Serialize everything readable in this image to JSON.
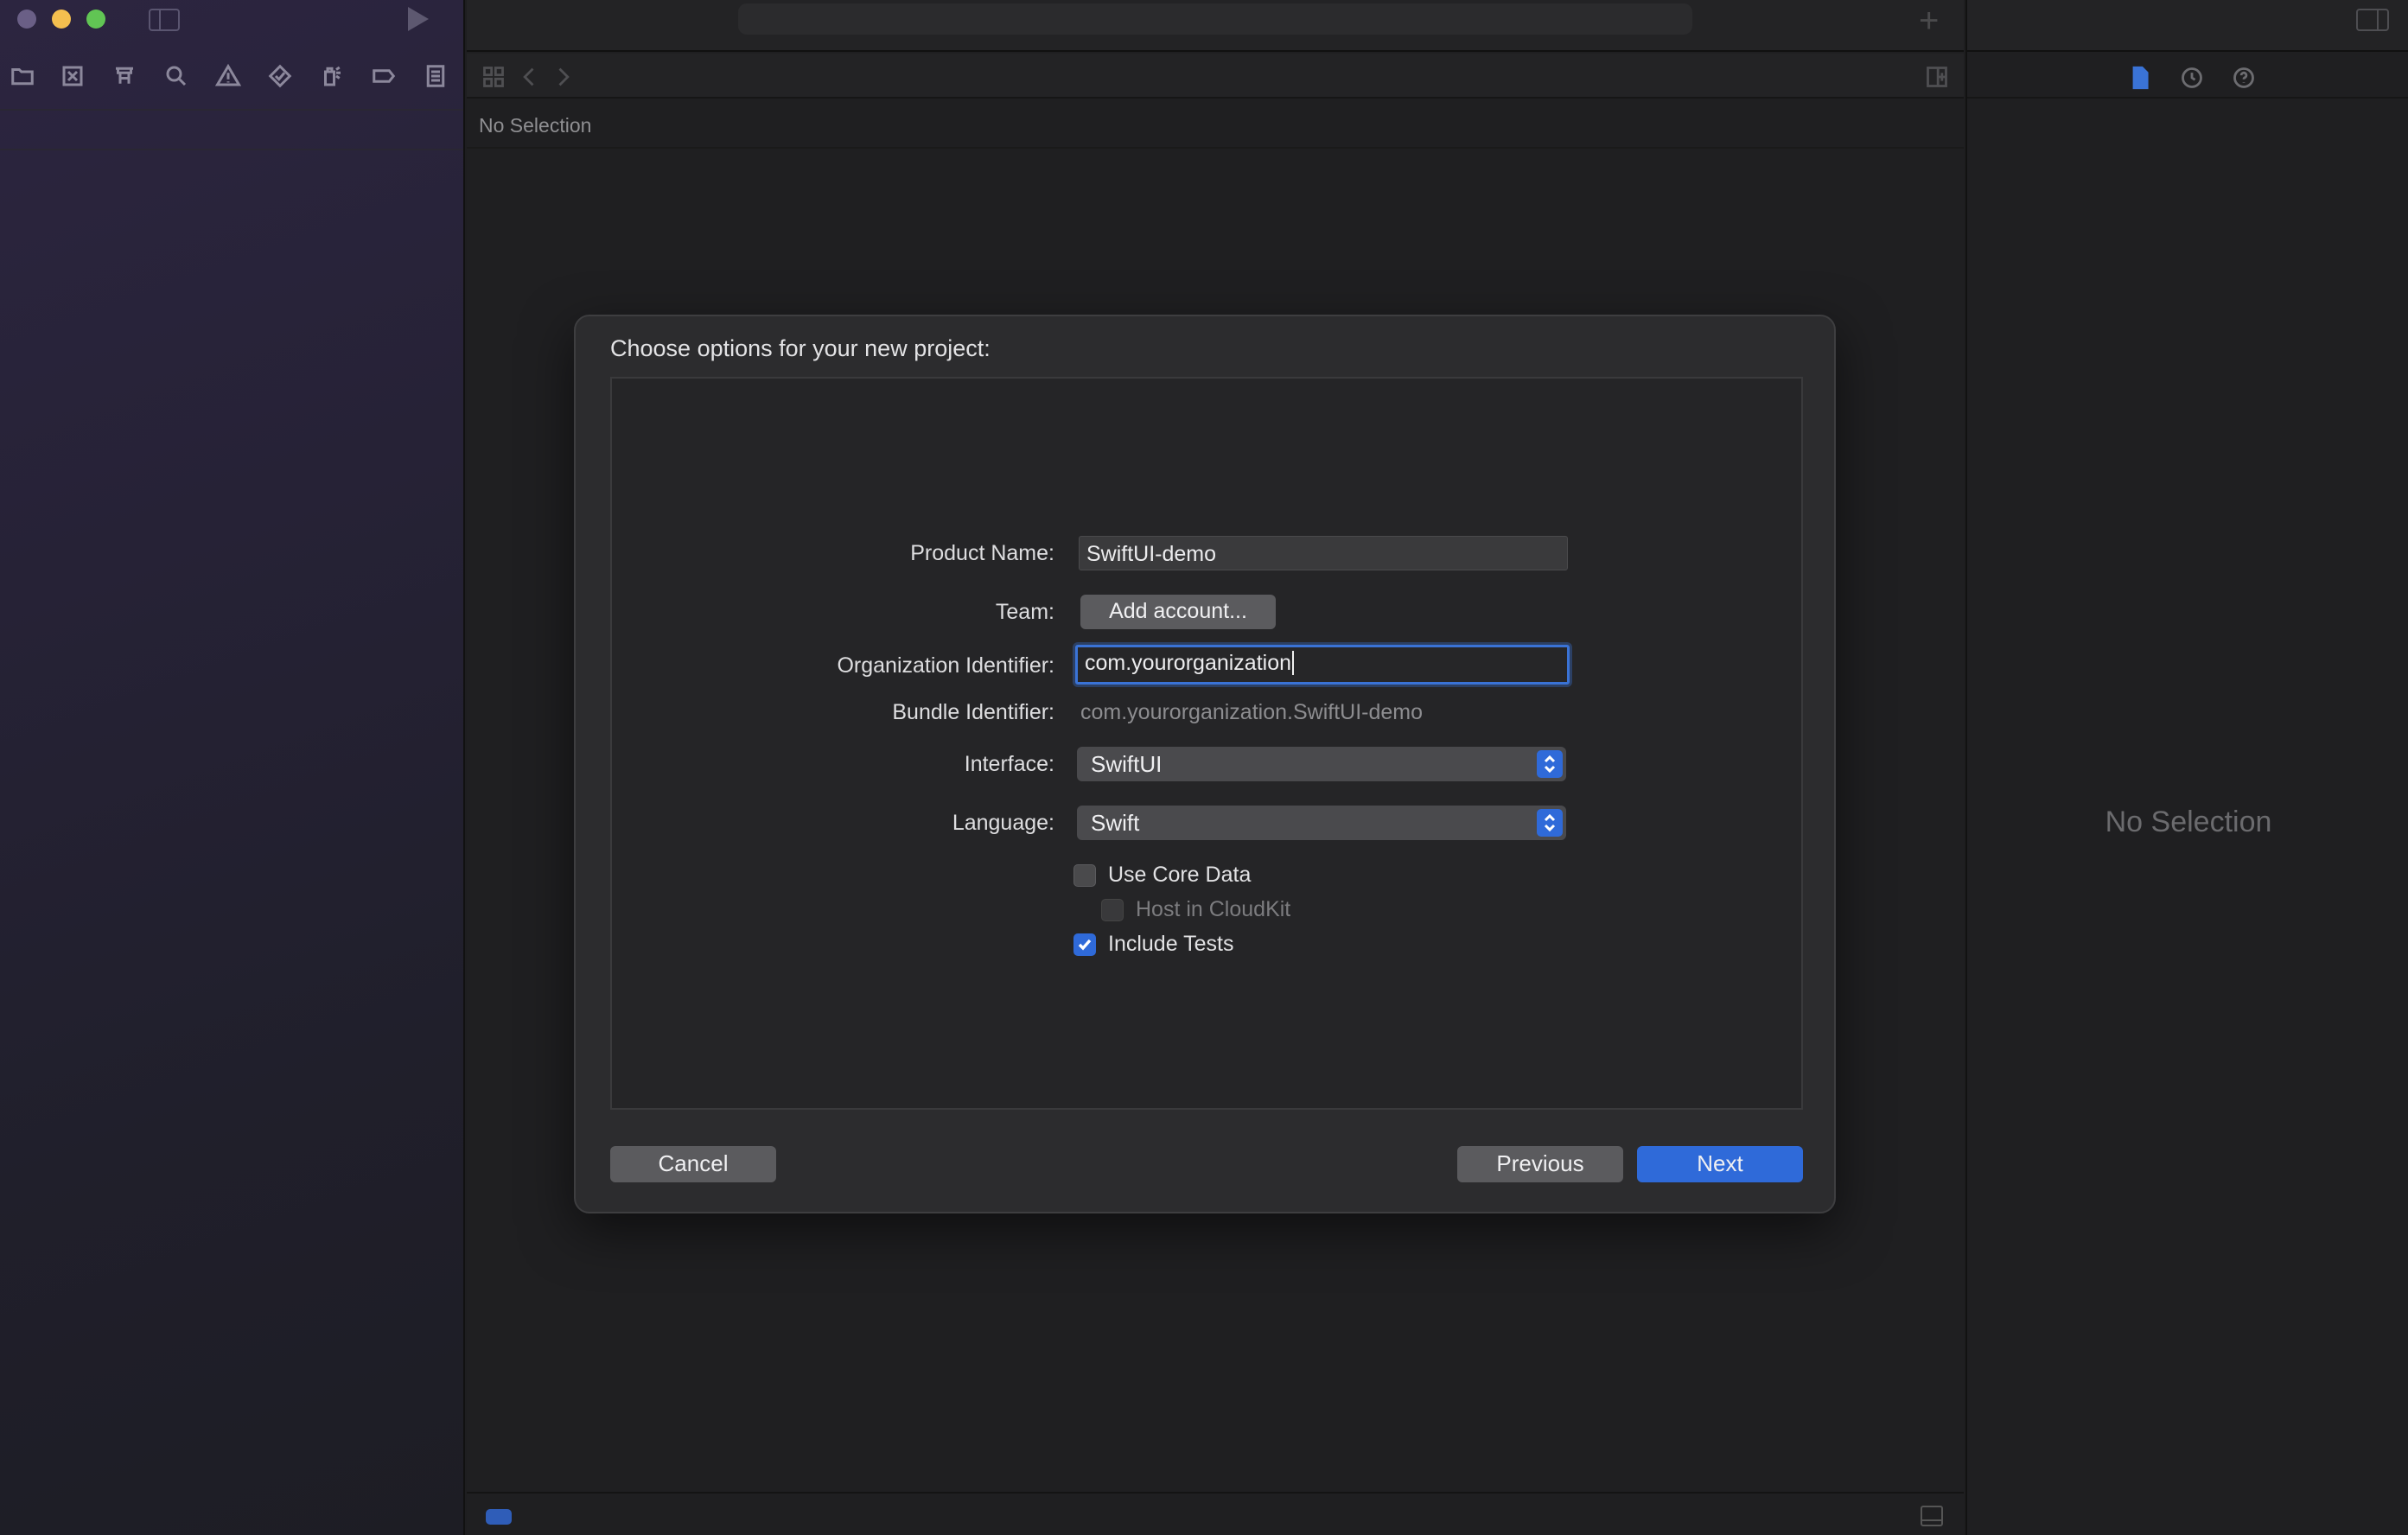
{
  "sidebar": {
    "navigator_icons": [
      "folder-icon",
      "source-control-icon",
      "symbol-icon",
      "search-icon",
      "warning-icon",
      "test-diamond-icon",
      "debug-spray-icon",
      "breakpoint-icon",
      "report-icon"
    ]
  },
  "editor": {
    "breadcrumb": "No Selection"
  },
  "inspector": {
    "empty_text": "No Selection",
    "tabs": [
      "file-inspector-icon",
      "history-icon",
      "help-icon"
    ]
  },
  "dialog": {
    "title": "Choose options for your new project:",
    "fields": {
      "product_name": {
        "label": "Product Name:",
        "value": "SwiftUI-demo"
      },
      "team": {
        "label": "Team:",
        "button": "Add account..."
      },
      "org_identifier": {
        "label": "Organization Identifier:",
        "value": "com.yourorganization"
      },
      "bundle_identifier": {
        "label": "Bundle Identifier:",
        "value": "com.yourorganization.SwiftUI-demo"
      },
      "interface": {
        "label": "Interface:",
        "selected": "SwiftUI"
      },
      "language": {
        "label": "Language:",
        "selected": "Swift"
      }
    },
    "checkboxes": {
      "use_core_data": {
        "label": "Use Core Data",
        "checked": false
      },
      "host_in_cloudkit": {
        "label": "Host in CloudKit",
        "checked": false,
        "enabled": false
      },
      "include_tests": {
        "label": "Include Tests",
        "checked": true
      }
    },
    "buttons": {
      "cancel": "Cancel",
      "previous": "Previous",
      "next": "Next"
    }
  },
  "colors": {
    "accent": "#2f6ad9",
    "traffic_close": "#6a5f86",
    "traffic_minimize": "#f4bf4f",
    "traffic_maximize": "#61c554"
  }
}
